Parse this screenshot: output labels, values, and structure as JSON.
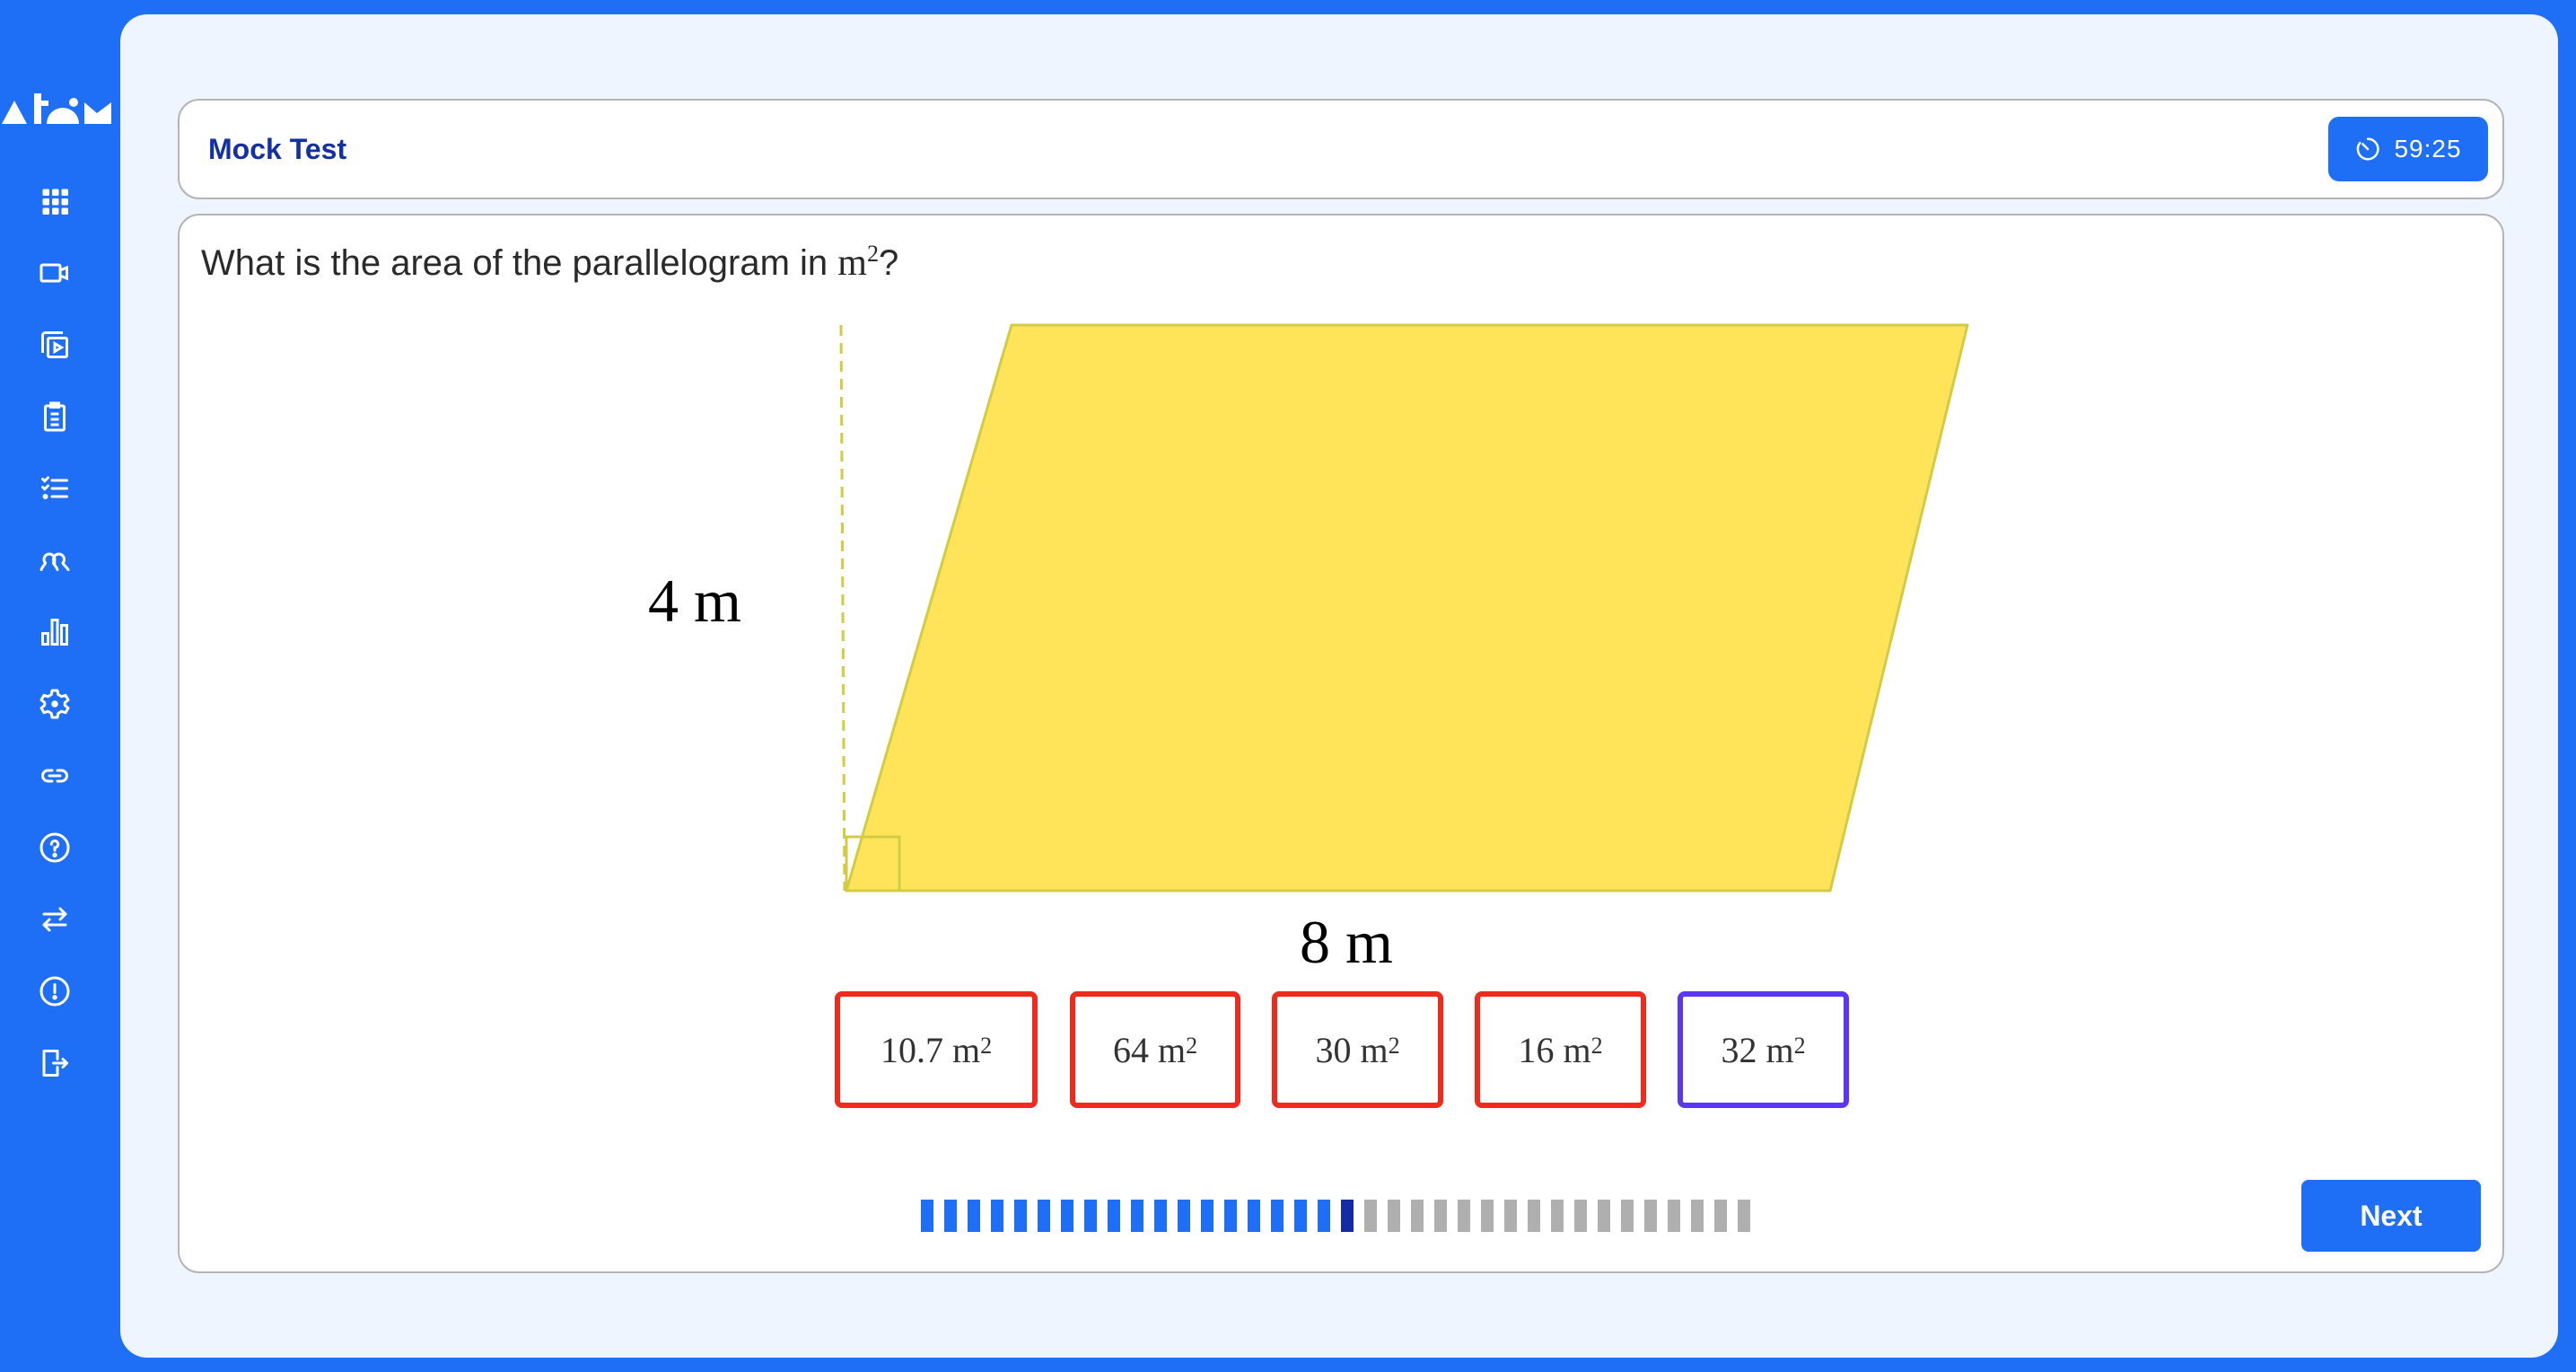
{
  "app": {
    "name": "Atom"
  },
  "sidebar": {
    "items": [
      {
        "name": "dashboard",
        "icon": "grid-icon"
      },
      {
        "name": "live-classes",
        "icon": "video-camera-icon"
      },
      {
        "name": "recorded-videos",
        "icon": "video-library-icon"
      },
      {
        "name": "tests",
        "icon": "clipboard-icon"
      },
      {
        "name": "checklist",
        "icon": "checklist-icon"
      },
      {
        "name": "community",
        "icon": "users-icon"
      },
      {
        "name": "analytics",
        "icon": "bar-chart-icon"
      },
      {
        "name": "settings",
        "icon": "gear-icon"
      },
      {
        "name": "links",
        "icon": "link-icon"
      },
      {
        "name": "help",
        "icon": "help-circle-icon"
      },
      {
        "name": "switch",
        "icon": "swap-arrows-icon"
      },
      {
        "name": "report",
        "icon": "alert-circle-icon"
      },
      {
        "name": "logout",
        "icon": "logout-icon"
      }
    ]
  },
  "header": {
    "title": "Mock Test",
    "timer": {
      "icon": "timer-icon",
      "value": "59:25"
    }
  },
  "question": {
    "prefix": "What is the area of the parallelogram in ",
    "unit": "m",
    "unit_exponent": "2",
    "suffix": "?",
    "figure": {
      "shape": "parallelogram",
      "height_label": "4 m",
      "base_label": "8 m",
      "fill_color": "#ffe45a",
      "stroke_color": "#d2cc44"
    }
  },
  "answers": [
    {
      "value": "10.7",
      "unit": "m",
      "exp": "2",
      "state": "incorrect"
    },
    {
      "value": "64",
      "unit": "m",
      "exp": "2",
      "state": "incorrect"
    },
    {
      "value": "30",
      "unit": "m",
      "exp": "2",
      "state": "incorrect"
    },
    {
      "value": "16",
      "unit": "m",
      "exp": "2",
      "state": "incorrect"
    },
    {
      "value": "32",
      "unit": "m",
      "exp": "2",
      "state": "selected"
    }
  ],
  "progress": {
    "total": 36,
    "completed": 18,
    "current": 19,
    "colors": {
      "done": "#1e6ff5",
      "current": "#132ca3",
      "pending": "#afafaf"
    }
  },
  "footer": {
    "next_label": "Next"
  },
  "colors": {
    "brand": "#1e6ff5",
    "title": "#1431a3",
    "incorrect": "#f02a1d",
    "selected": "#5b37f5",
    "background": "#eef5fe"
  }
}
